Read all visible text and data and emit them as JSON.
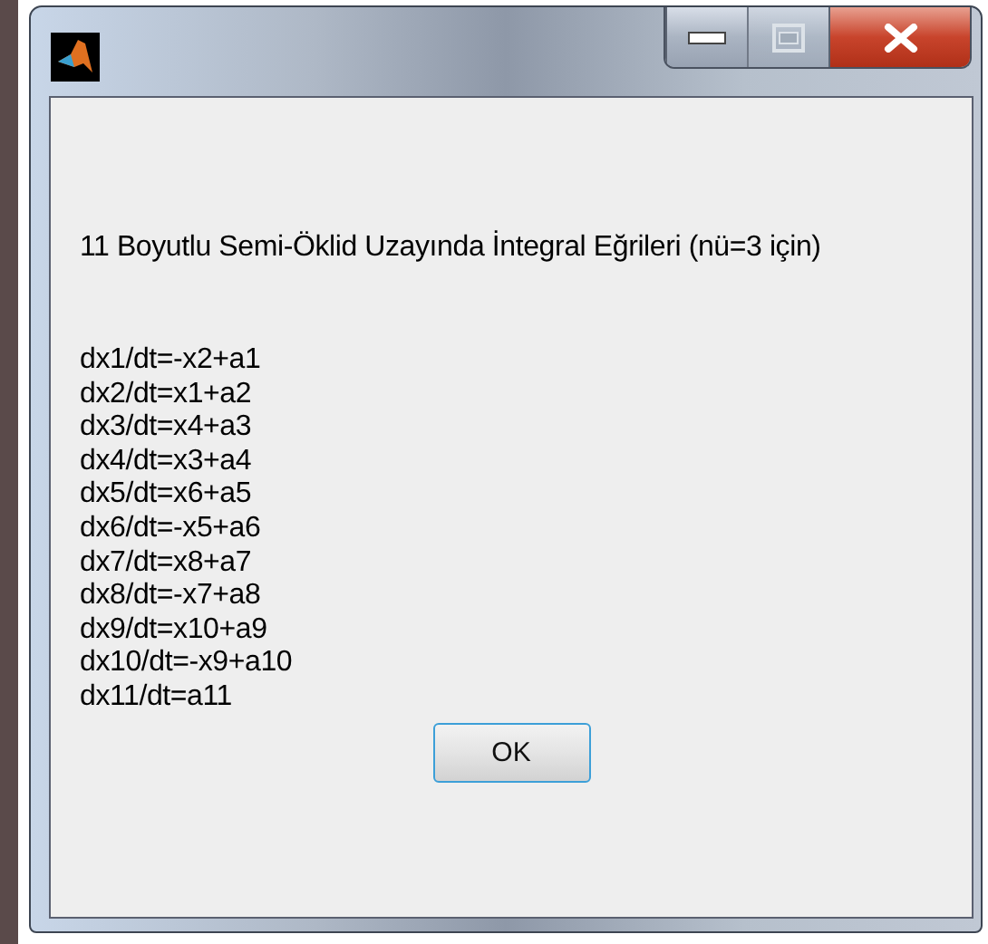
{
  "window": {
    "controls": [
      {
        "kind": "minimize"
      },
      {
        "kind": "maximize",
        "disabled": true
      },
      {
        "kind": "close"
      }
    ]
  },
  "heading": "11 Boyutlu Semi-Öklid Uzayında İntegral Eğrileri (nü=3 için)",
  "equations": [
    "dx1/dt=-x2+a1",
    "dx2/dt=x1+a2",
    "dx3/dt=x4+a3",
    "dx4/dt=x3+a4",
    "dx5/dt=x6+a5",
    "dx6/dt=-x5+a6",
    "dx7/dt=x8+a7",
    "dx8/dt=-x7+a8",
    "dx9/dt=x10+a9",
    "dx10/dt=-x9+a10",
    "dx11/dt=a11"
  ],
  "button": "OK"
}
